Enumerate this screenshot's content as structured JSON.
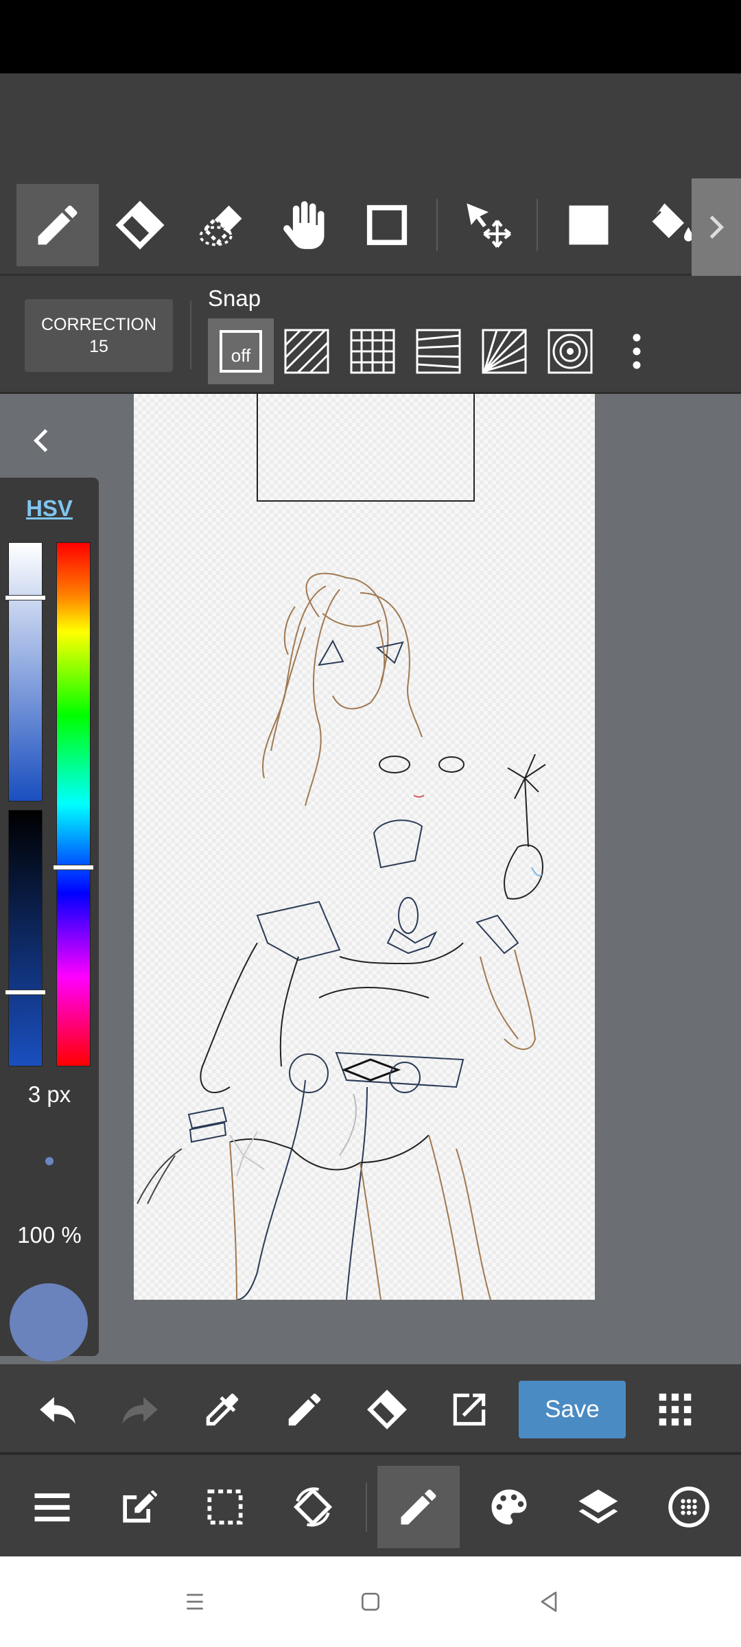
{
  "toolbar": {
    "tools": [
      {
        "name": "pen-icon",
        "active": true
      },
      {
        "name": "eraser-icon"
      },
      {
        "name": "blur-eraser-icon"
      },
      {
        "name": "hand-icon"
      },
      {
        "name": "rectangle-icon"
      },
      {
        "name": "move-select-icon"
      },
      {
        "name": "fill-icon"
      },
      {
        "name": "bucket-icon"
      }
    ]
  },
  "subbar": {
    "correction_label": "CORRECTION",
    "correction_value": "15",
    "snap_label": "Snap",
    "snap_off_label": "off"
  },
  "color_panel": {
    "mode_label": "HSV",
    "brush_size": "3 px",
    "opacity": "100 %",
    "current_color": "#6a83bd",
    "saturation_level": 0.21,
    "hue_level": 0.62,
    "value_level": 0.71
  },
  "actionbar": {
    "save_label": "Save"
  },
  "colors": {
    "accent": "#4b8bc4",
    "hsv_link": "#7fc6ee"
  }
}
